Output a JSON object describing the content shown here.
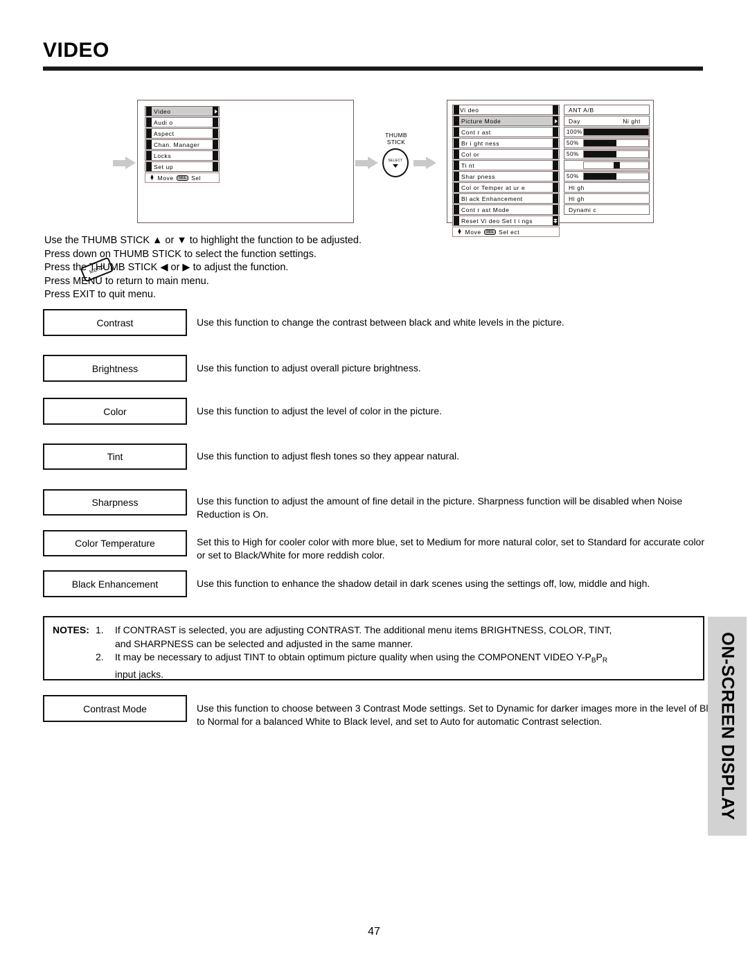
{
  "page": {
    "title": "VIDEO",
    "number": "47",
    "side_tab": "ON-SCREEN DISPLAY"
  },
  "diagram": {
    "menu_button_label": "MENU",
    "thumbstick": {
      "line1": "THUMB",
      "line2": "STICK",
      "select_label": "SELECT"
    },
    "main_menu": {
      "items": [
        {
          "label": "Video",
          "selected": true,
          "arrow": true
        },
        {
          "label": "Audi o",
          "selected": false,
          "arrow": false
        },
        {
          "label": "Aspect",
          "selected": false,
          "arrow": false
        },
        {
          "label": "Chan.  Manager",
          "selected": false,
          "arrow": false
        },
        {
          "label": "Locks",
          "selected": false,
          "arrow": false
        },
        {
          "label": "Set up",
          "selected": false,
          "arrow": false
        }
      ],
      "footer": {
        "move": "Move",
        "key": "SEL",
        "select": "Sel"
      }
    },
    "video_menu": {
      "header": "Vi deo",
      "value_header": "ANT A/B",
      "rows": [
        {
          "label": "Picture Mode",
          "selected": true,
          "arrow": true,
          "value_type": "daynight",
          "value_left": "Day",
          "value_right": "Ni ght"
        },
        {
          "label": "Cont r ast",
          "selected": false,
          "arrow": false,
          "value_type": "bar",
          "percent": "100%",
          "fill": 100
        },
        {
          "label": "Br i ght ness",
          "selected": false,
          "arrow": false,
          "value_type": "bar",
          "percent": "50%",
          "fill": 50
        },
        {
          "label": "Col or",
          "selected": false,
          "arrow": false,
          "value_type": "bar",
          "percent": "50%",
          "fill": 50
        },
        {
          "label": "Ti nt",
          "selected": false,
          "arrow": false,
          "value_type": "knob",
          "percent": "",
          "knob": 50
        },
        {
          "label": "Shar pness",
          "selected": false,
          "arrow": false,
          "value_type": "bar",
          "percent": "50%",
          "fill": 50
        },
        {
          "label": "Col or   Temper at ur e",
          "selected": false,
          "arrow": false,
          "value_type": "text",
          "value": "Hi gh"
        },
        {
          "label": "Bl ack  Enhancement",
          "selected": false,
          "arrow": false,
          "value_type": "text",
          "value": "Hi gh"
        },
        {
          "label": "Cont r ast   Mode",
          "selected": false,
          "arrow": false,
          "value_type": "text",
          "value": "Dynami c"
        },
        {
          "label": "Reset   Vi deo Set t i ngs",
          "selected": false,
          "arrow": false,
          "double": true,
          "value_type": "none",
          "value": ""
        }
      ],
      "footer": {
        "move": "Move",
        "key": "SEL",
        "select": "Sel ect"
      }
    }
  },
  "instructions": [
    "Use the THUMB STICK ▲ or ▼ to highlight the function to be adjusted.",
    "Press down on THUMB STICK to select the function settings.",
    "Press the THUMB STICK ◀ or ▶ to adjust the function.",
    "Press MENU to return to main menu.",
    "Press EXIT to quit menu."
  ],
  "functions": [
    {
      "name": "Contrast",
      "description": "Use this function to change the contrast between black and white levels in the picture."
    },
    {
      "name": "Brightness",
      "description": "Use this function to adjust overall picture brightness."
    },
    {
      "name": "Color",
      "description": "Use this function to adjust the level of color in the picture."
    },
    {
      "name": "Tint",
      "description": "Use this function to adjust flesh tones so they appear natural."
    },
    {
      "name": "Sharpness",
      "description": "Use this function to adjust the amount of fine detail in the picture.  Sharpness function will be disabled when Noise Reduction is On."
    },
    {
      "name": "Color Temperature",
      "description": "Set this to High for cooler color with more blue, set to Medium for more natural color, set to Standard for accurate color or set to Black/White for more reddish color."
    },
    {
      "name": "Black Enhancement",
      "description": "Use this function to enhance the shadow detail in dark scenes using the settings off, low, middle and high."
    },
    {
      "name": "Contrast Mode",
      "description": "Use this function to choose between 3 Contrast Mode settings.  Set to Dynamic for darker images more in the level of Black, set to Normal for a balanced White to Black level, and set to Auto for automatic Contrast selection."
    }
  ],
  "notes": {
    "label": "NOTES:",
    "items": [
      {
        "number": "1.",
        "line1": "If CONTRAST is selected, you are adjusting CONTRAST.  The additional menu items BRIGHTNESS, COLOR, TINT,",
        "line2": "and SHARPNESS can be selected and adjusted in the same manner."
      },
      {
        "number": "2.",
        "line1_a": "It may be necessary to adjust TINT to obtain optimum picture quality when using the COMPONENT VIDEO Y-P",
        "line1_sub1": "B",
        "line1_b": "P",
        "line1_sub2": "R",
        "line2": "input jacks."
      }
    ]
  }
}
